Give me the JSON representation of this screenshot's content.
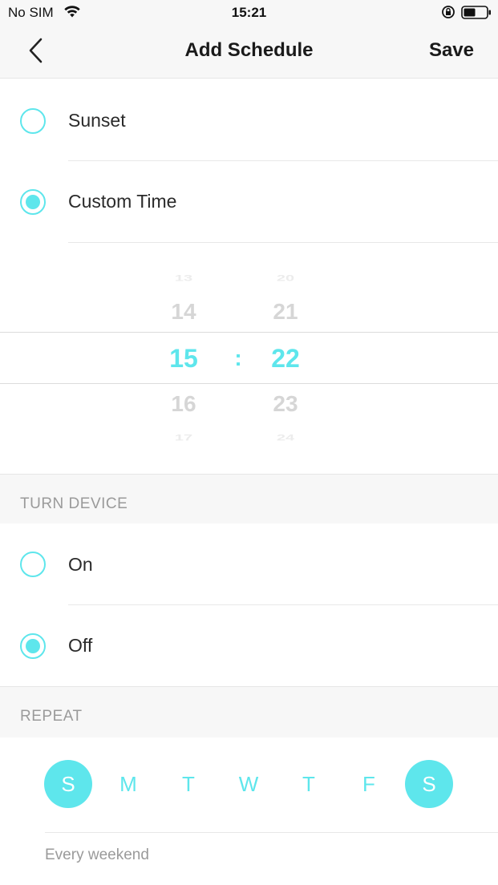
{
  "status_bar": {
    "carrier": "No SIM",
    "time": "15:21",
    "wifi_icon": "wifi-icon",
    "lock_icon": "orientation-lock-icon",
    "battery_icon": "battery-icon"
  },
  "nav": {
    "back_icon": "chevron-left-icon",
    "title": "Add Schedule",
    "save_label": "Save"
  },
  "time_options": [
    {
      "label": "Sunset",
      "selected": false
    },
    {
      "label": "Custom Time",
      "selected": true
    }
  ],
  "time_picker": {
    "hours": [
      "13",
      "14",
      "15",
      "16",
      "17"
    ],
    "minutes": [
      "20",
      "21",
      "22",
      "23",
      "24"
    ],
    "separator": ":",
    "selected_hour": "15",
    "selected_minute": "22"
  },
  "turn_device": {
    "header": "TURN DEVICE",
    "options": [
      {
        "label": "On",
        "selected": false
      },
      {
        "label": "Off",
        "selected": true
      }
    ]
  },
  "repeat": {
    "header": "REPEAT",
    "days": [
      {
        "label": "S",
        "selected": true
      },
      {
        "label": "M",
        "selected": false
      },
      {
        "label": "T",
        "selected": false
      },
      {
        "label": "W",
        "selected": false
      },
      {
        "label": "T",
        "selected": false
      },
      {
        "label": "F",
        "selected": false
      },
      {
        "label": "S",
        "selected": true
      }
    ],
    "summary": "Every weekend"
  },
  "colors": {
    "accent": "#5ee6ec",
    "muted_text": "#9a9a9a",
    "section_bg": "#f7f7f7"
  }
}
